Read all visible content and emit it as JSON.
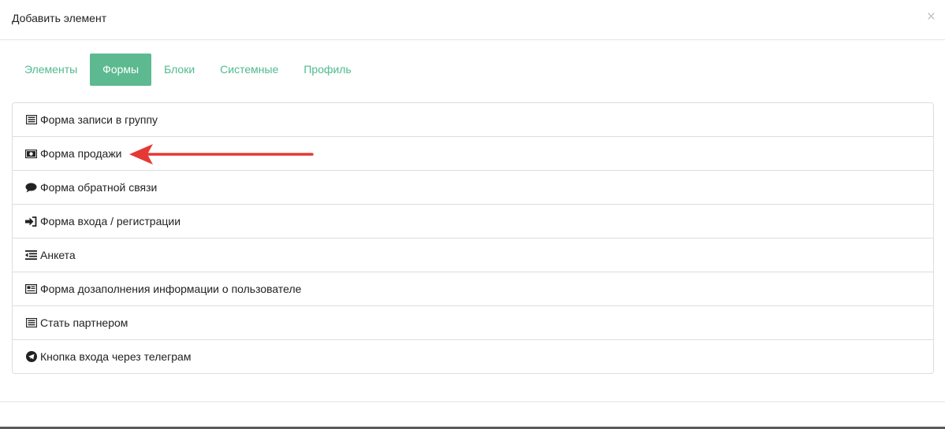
{
  "modal": {
    "title": "Добавить элемент",
    "close_label": "×"
  },
  "tabs": [
    {
      "label": "Элементы",
      "active": false
    },
    {
      "label": "Формы",
      "active": true
    },
    {
      "label": "Блоки",
      "active": false
    },
    {
      "label": "Системные",
      "active": false
    },
    {
      "label": "Профиль",
      "active": false
    }
  ],
  "items": [
    {
      "label": "Форма записи в группу",
      "icon": "list-alt-icon"
    },
    {
      "label": "Форма продажи",
      "icon": "money-icon"
    },
    {
      "label": "Форма обратной связи",
      "icon": "comment-icon"
    },
    {
      "label": "Форма входа / регистрации",
      "icon": "sign-in-icon"
    },
    {
      "label": "Анкета",
      "icon": "outdent-icon"
    },
    {
      "label": "Форма дозаполнения информации о пользователе",
      "icon": "newspaper-icon"
    },
    {
      "label": "Стать партнером",
      "icon": "list-alt-icon"
    },
    {
      "label": "Кнопка входа через телеграм",
      "icon": "telegram-icon"
    }
  ],
  "colors": {
    "accent": "#5cb990",
    "tab_text": "#4fba8e",
    "annotation_arrow": "#e53935"
  }
}
